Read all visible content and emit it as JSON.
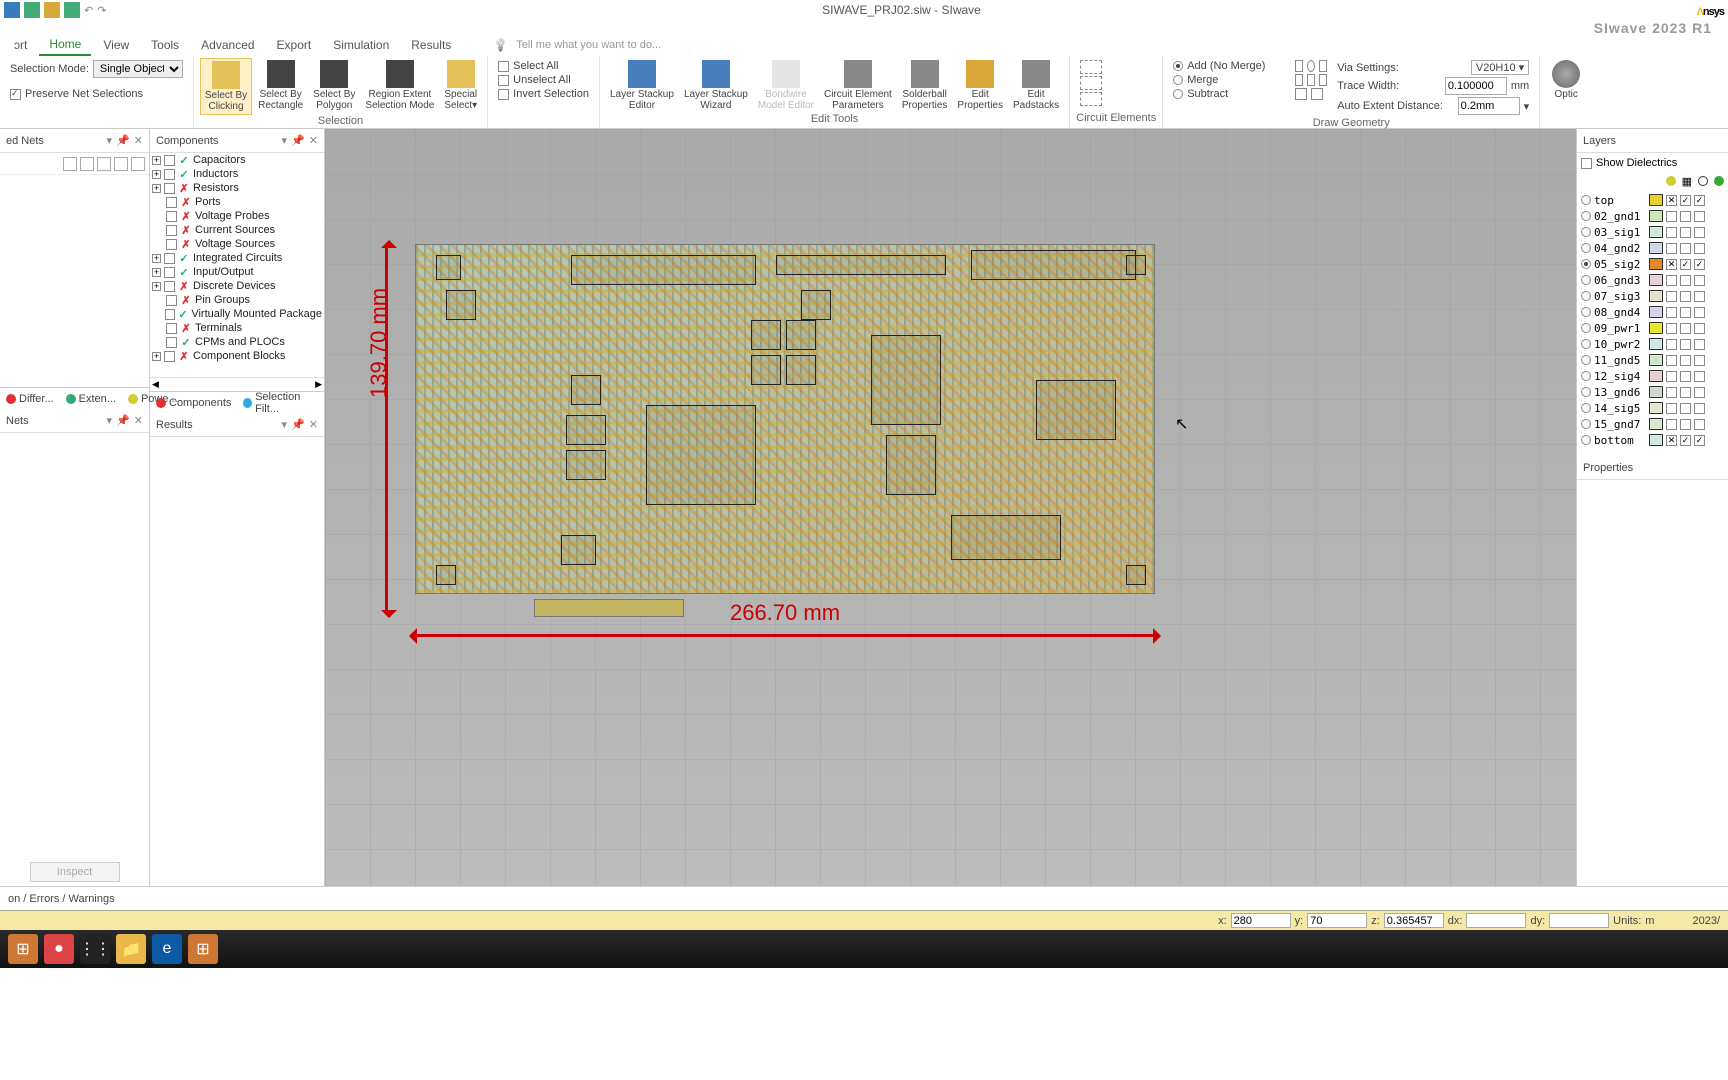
{
  "app": {
    "title": "SIWAVE_PRJ02.siw - SIwave",
    "brand_pre": "Λ",
    "brand": "nsys",
    "product": "SIwave 2023 R1"
  },
  "tabs": {
    "items": [
      "ɔrt",
      "Home",
      "View",
      "Tools",
      "Advanced",
      "Export",
      "Simulation",
      "Results"
    ],
    "active": 1,
    "tell_me": "Tell me what you want to do..."
  },
  "ribbon": {
    "selection_mode_label": "Selection Mode:",
    "selection_mode_value": "Single Object",
    "preserve_nets": "Preserve Net Selections",
    "select_buttons": [
      {
        "label": "Select By\nClicking",
        "sel": true
      },
      {
        "label": "Select By\nRectangle"
      },
      {
        "label": "Select By\nPolygon"
      },
      {
        "label": "Region Extent\nSelection Mode"
      },
      {
        "label": "Special\nSelect▾"
      }
    ],
    "selection_group": "Selection",
    "select_all": "Select All",
    "unselect_all": "Unselect All",
    "invert_selection": "Invert Selection",
    "edit_buttons": [
      {
        "label": "Layer Stackup\nEditor"
      },
      {
        "label": "Layer Stackup\nWizard"
      },
      {
        "label": "Bondwire\nModel Editor",
        "disabled": true
      },
      {
        "label": "Circuit Element\nParameters"
      },
      {
        "label": "Solderball\nProperties"
      },
      {
        "label": "Edit\nProperties"
      },
      {
        "label": "Edit\nPadstacks"
      }
    ],
    "edit_group": "Edit Tools",
    "circuit_group": "Circuit Elements",
    "draw_geo": {
      "add": "Add (No Merge)",
      "merge": "Merge",
      "subtract": "Subtract",
      "via_settings": "Via Settings:",
      "via_value": "V20H10 ▾",
      "trace_width": "Trace Width:",
      "trace_value": "0.100000",
      "trace_unit": "mm",
      "auto_extent": "Auto Extent Distance:",
      "auto_value": "0.2mm"
    },
    "draw_group": "Draw Geometry",
    "optic": "Optic"
  },
  "panels": {
    "nets_title": "ed Nets",
    "components_title": "Components",
    "results_title": "Results",
    "layers_title": "Layers",
    "properties_title": "Properties",
    "inspect": "Inspect"
  },
  "component_tree": [
    {
      "name": "Capacitors",
      "status": "g",
      "expandable": true
    },
    {
      "name": "Inductors",
      "status": "g",
      "expandable": true
    },
    {
      "name": "Resistors",
      "status": "r",
      "expandable": true
    },
    {
      "name": "Ports",
      "status": "r",
      "expandable": false
    },
    {
      "name": "Voltage Probes",
      "status": "r",
      "expandable": false
    },
    {
      "name": "Current Sources",
      "status": "r",
      "expandable": false
    },
    {
      "name": "Voltage Sources",
      "status": "r",
      "expandable": false
    },
    {
      "name": "Integrated Circuits",
      "status": "g",
      "expandable": true
    },
    {
      "name": "Input/Output",
      "status": "g",
      "expandable": true
    },
    {
      "name": "Discrete Devices",
      "status": "r",
      "expandable": true
    },
    {
      "name": "Pin Groups",
      "status": "r",
      "expandable": false
    },
    {
      "name": "Virtually Mounted Package",
      "status": "g",
      "expandable": false
    },
    {
      "name": "Terminals",
      "status": "r",
      "expandable": false
    },
    {
      "name": "CPMs and PLOCs",
      "status": "g",
      "expandable": false
    },
    {
      "name": "Component Blocks",
      "status": "r",
      "expandable": true
    }
  ],
  "bottom_tabs_left": [
    "Differ...",
    "Exten...",
    "Powe..."
  ],
  "bottom_tabs_mid": [
    "Components",
    "Selection Filt..."
  ],
  "dimensions": {
    "width": "266.70 mm",
    "height": "139.70 mm"
  },
  "layers": {
    "show_dielectrics": "Show Dielectrics",
    "rows": [
      {
        "name": "top",
        "color": "#e6d02a",
        "c1": true,
        "c2": true,
        "c3": true
      },
      {
        "name": "02_gnd1",
        "color": "#cfe8b8"
      },
      {
        "name": "03_sig1",
        "color": "#cfe8d8"
      },
      {
        "name": "04_gnd2",
        "color": "#cfd8e8"
      },
      {
        "name": "05_sig2",
        "color": "#e68a2a",
        "radio": true,
        "c1": true,
        "c2": true,
        "c3": true
      },
      {
        "name": "06_gnd3",
        "color": "#e8cfd8"
      },
      {
        "name": "07_sig3",
        "color": "#e8e3cf"
      },
      {
        "name": "08_gnd4",
        "color": "#d8cfe8"
      },
      {
        "name": "09_pwr1",
        "color": "#e6e62a"
      },
      {
        "name": "10_pwr2",
        "color": "#cfe8e8"
      },
      {
        "name": "11_gnd5",
        "color": "#cfe8cf"
      },
      {
        "name": "12_sig4",
        "color": "#e8cfcf"
      },
      {
        "name": "13_gnd6",
        "color": "#cfd8cf"
      },
      {
        "name": "14_sig5",
        "color": "#e8e8cf"
      },
      {
        "name": "15_gnd7",
        "color": "#d8e8cf"
      },
      {
        "name": "bottom",
        "color": "#cfe8e4",
        "c1": true,
        "c2": true,
        "c3": true
      }
    ]
  },
  "coords": {
    "x_label": "x:",
    "x": "280",
    "y_label": "y:",
    "y": "70",
    "z_label": "z:",
    "z": "0.365457",
    "dx_label": "dx:",
    "dx": "",
    "dy_label": "dy:",
    "dy": "",
    "units_label": "Units:",
    "units": "m",
    "date": "2023/"
  },
  "errbar": "on / Errors / Warnings"
}
